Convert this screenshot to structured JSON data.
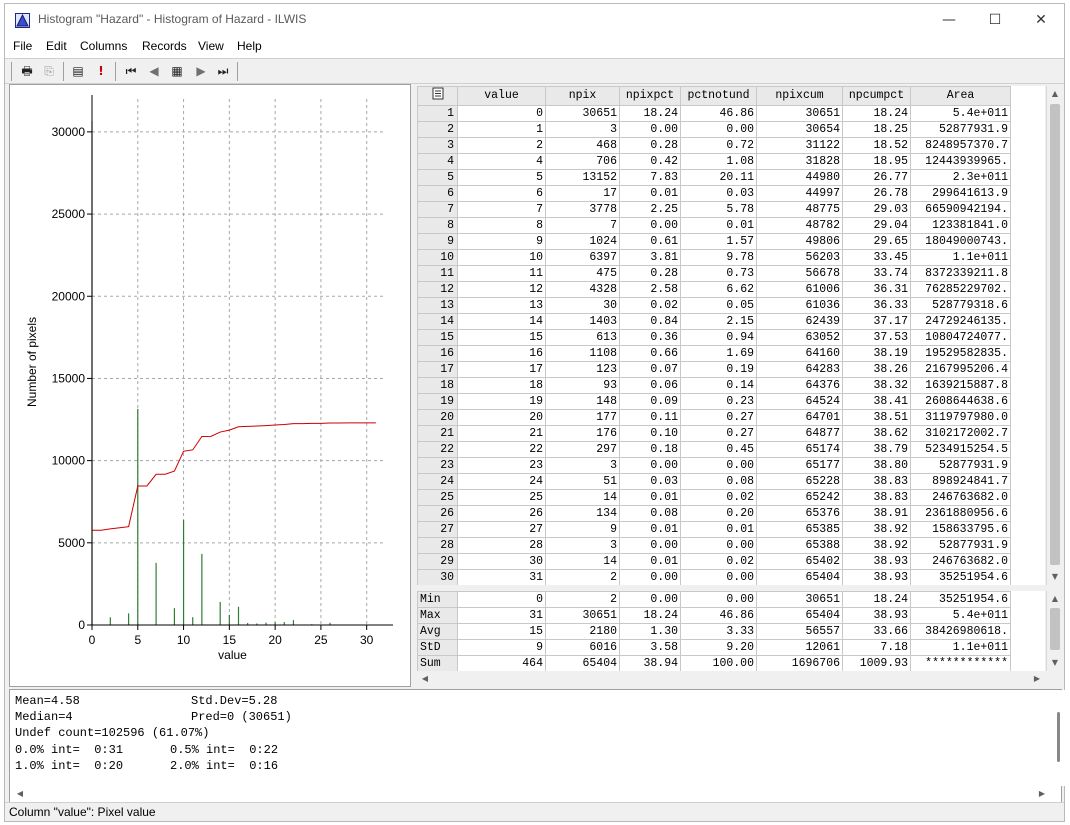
{
  "window": {
    "title": "Histogram \"Hazard\" - Histogram of Hazard - ILWIS",
    "controls": {
      "minimize": "—",
      "maximize": "☐",
      "close": "✕"
    }
  },
  "menu": [
    "File",
    "Edit",
    "Columns",
    "Records",
    "View",
    "Help"
  ],
  "toolbar": [
    {
      "icon": "print-icon",
      "glyph": "🖶"
    },
    {
      "icon": "copy-icon",
      "glyph": "⎘"
    },
    {
      "icon": "properties-icon",
      "glyph": "▤"
    },
    {
      "icon": "exclamation-icon",
      "glyph": "!"
    },
    {
      "icon": "first-record-icon",
      "glyph": "⏮"
    },
    {
      "icon": "previous-record-icon",
      "glyph": "◀"
    },
    {
      "icon": "goto-record-icon",
      "glyph": "▦"
    },
    {
      "icon": "next-record-icon",
      "glyph": "▶"
    },
    {
      "icon": "last-record-icon",
      "glyph": "⏭"
    }
  ],
  "chart_data": {
    "type": "bar",
    "xlabel": "value",
    "ylabel": "Number of pixels",
    "xlim": [
      0,
      32
    ],
    "ylim": [
      0,
      32000
    ],
    "xticks": [
      0,
      5,
      10,
      15,
      20,
      25,
      30
    ],
    "yticks": [
      0,
      5000,
      10000,
      15000,
      20000,
      25000,
      30000
    ],
    "grid": true,
    "bar_color": "#2e7d32",
    "line_color": "#cc0000",
    "bars": {
      "x": [
        0,
        1,
        2,
        4,
        5,
        6,
        7,
        8,
        9,
        10,
        11,
        12,
        13,
        14,
        15,
        16,
        17,
        18,
        19,
        20,
        21,
        22,
        23,
        24,
        25,
        26,
        27,
        28,
        30,
        31
      ],
      "values": [
        30651,
        3,
        468,
        706,
        13152,
        17,
        3778,
        7,
        1024,
        6397,
        475,
        4328,
        30,
        1403,
        613,
        1108,
        123,
        93,
        148,
        177,
        176,
        297,
        3,
        51,
        14,
        134,
        9,
        3,
        14,
        2
      ]
    },
    "cumulative_line": {
      "x": [
        0,
        1,
        2,
        4,
        5,
        6,
        7,
        8,
        9,
        10,
        11,
        12,
        13,
        14,
        15,
        16,
        17,
        18,
        19,
        20,
        21,
        22,
        23,
        24,
        25,
        26,
        27,
        28,
        30,
        31
      ],
      "values": [
        30651,
        30654,
        31122,
        31828,
        44980,
        44997,
        48775,
        48782,
        49806,
        56203,
        56678,
        61006,
        61036,
        62439,
        63052,
        64160,
        64283,
        64376,
        64524,
        64701,
        64877,
        65174,
        65177,
        65228,
        65242,
        65376,
        65385,
        65388,
        65402,
        65404
      ],
      "display_scale": 0.188
    }
  },
  "table": {
    "columns": [
      "value",
      "npix",
      "npixpct",
      "pctnotund",
      "npixcum",
      "npcumpct",
      "Area"
    ],
    "rows": [
      [
        "1",
        "0",
        "30651",
        "18.24",
        "46.86",
        "30651",
        "18.24",
        "5.4e+011"
      ],
      [
        "2",
        "1",
        "3",
        "0.00",
        "0.00",
        "30654",
        "18.25",
        "52877931.9"
      ],
      [
        "3",
        "2",
        "468",
        "0.28",
        "0.72",
        "31122",
        "18.52",
        "8248957370.7"
      ],
      [
        "4",
        "4",
        "706",
        "0.42",
        "1.08",
        "31828",
        "18.95",
        "12443939965."
      ],
      [
        "5",
        "5",
        "13152",
        "7.83",
        "20.11",
        "44980",
        "26.77",
        "2.3e+011"
      ],
      [
        "6",
        "6",
        "17",
        "0.01",
        "0.03",
        "44997",
        "26.78",
        "299641613.9"
      ],
      [
        "7",
        "7",
        "3778",
        "2.25",
        "5.78",
        "48775",
        "29.03",
        "66590942194."
      ],
      [
        "8",
        "8",
        "7",
        "0.00",
        "0.01",
        "48782",
        "29.04",
        "123381841.0"
      ],
      [
        "9",
        "9",
        "1024",
        "0.61",
        "1.57",
        "49806",
        "29.65",
        "18049000743."
      ],
      [
        "10",
        "10",
        "6397",
        "3.81",
        "9.78",
        "56203",
        "33.45",
        "1.1e+011"
      ],
      [
        "11",
        "11",
        "475",
        "0.28",
        "0.73",
        "56678",
        "33.74",
        "8372339211.8"
      ],
      [
        "12",
        "12",
        "4328",
        "2.58",
        "6.62",
        "61006",
        "36.31",
        "76285229702."
      ],
      [
        "13",
        "13",
        "30",
        "0.02",
        "0.05",
        "61036",
        "36.33",
        "528779318.6"
      ],
      [
        "14",
        "14",
        "1403",
        "0.84",
        "2.15",
        "62439",
        "37.17",
        "24729246135."
      ],
      [
        "15",
        "15",
        "613",
        "0.36",
        "0.94",
        "63052",
        "37.53",
        "10804724077."
      ],
      [
        "16",
        "16",
        "1108",
        "0.66",
        "1.69",
        "64160",
        "38.19",
        "19529582835."
      ],
      [
        "17",
        "17",
        "123",
        "0.07",
        "0.19",
        "64283",
        "38.26",
        "2167995206.4"
      ],
      [
        "18",
        "18",
        "93",
        "0.06",
        "0.14",
        "64376",
        "38.32",
        "1639215887.8"
      ],
      [
        "19",
        "19",
        "148",
        "0.09",
        "0.23",
        "64524",
        "38.41",
        "2608644638.6"
      ],
      [
        "20",
        "20",
        "177",
        "0.11",
        "0.27",
        "64701",
        "38.51",
        "3119797980.0"
      ],
      [
        "21",
        "21",
        "176",
        "0.10",
        "0.27",
        "64877",
        "38.62",
        "3102172002.7"
      ],
      [
        "22",
        "22",
        "297",
        "0.18",
        "0.45",
        "65174",
        "38.79",
        "5234915254.5"
      ],
      [
        "23",
        "23",
        "3",
        "0.00",
        "0.00",
        "65177",
        "38.80",
        "52877931.9"
      ],
      [
        "24",
        "24",
        "51",
        "0.03",
        "0.08",
        "65228",
        "38.83",
        "898924841.7"
      ],
      [
        "25",
        "25",
        "14",
        "0.01",
        "0.02",
        "65242",
        "38.83",
        "246763682.0"
      ],
      [
        "26",
        "26",
        "134",
        "0.08",
        "0.20",
        "65376",
        "38.91",
        "2361880956.6"
      ],
      [
        "27",
        "27",
        "9",
        "0.01",
        "0.01",
        "65385",
        "38.92",
        "158633795.6"
      ],
      [
        "28",
        "28",
        "3",
        "0.00",
        "0.00",
        "65388",
        "38.92",
        "52877931.9"
      ],
      [
        "29",
        "30",
        "14",
        "0.01",
        "0.02",
        "65402",
        "38.93",
        "246763682.0"
      ],
      [
        "30",
        "31",
        "2",
        "0.00",
        "0.00",
        "65404",
        "38.93",
        "35251954.6"
      ]
    ],
    "stats": [
      [
        "Min",
        "0",
        "2",
        "0.00",
        "0.00",
        "30651",
        "18.24",
        "35251954.6"
      ],
      [
        "Max",
        "31",
        "30651",
        "18.24",
        "46.86",
        "65404",
        "38.93",
        "5.4e+011"
      ],
      [
        "Avg",
        "15",
        "2180",
        "1.30",
        "3.33",
        "56557",
        "33.66",
        "38426980618."
      ],
      [
        "StD",
        "9",
        "6016",
        "3.58",
        "9.20",
        "12061",
        "7.18",
        "1.1e+011"
      ],
      [
        "Sum",
        "464",
        "65404",
        "38.94",
        "100.00",
        "1696706",
        "1009.93",
        "************"
      ]
    ]
  },
  "info": {
    "mean": "Mean=4.58",
    "stddev": "Std.Dev=5.28",
    "median": "Median=4",
    "pred": "Pred=0 (30651)",
    "undef": "Undef count=102596 (61.07%)",
    "int00": "0.0% int=  0:31",
    "int05": "0.5% int=  0:22",
    "int10": "1.0% int=  0:20",
    "int20": "2.0% int=  0:16"
  },
  "status": "Column \"value\": Pixel value"
}
